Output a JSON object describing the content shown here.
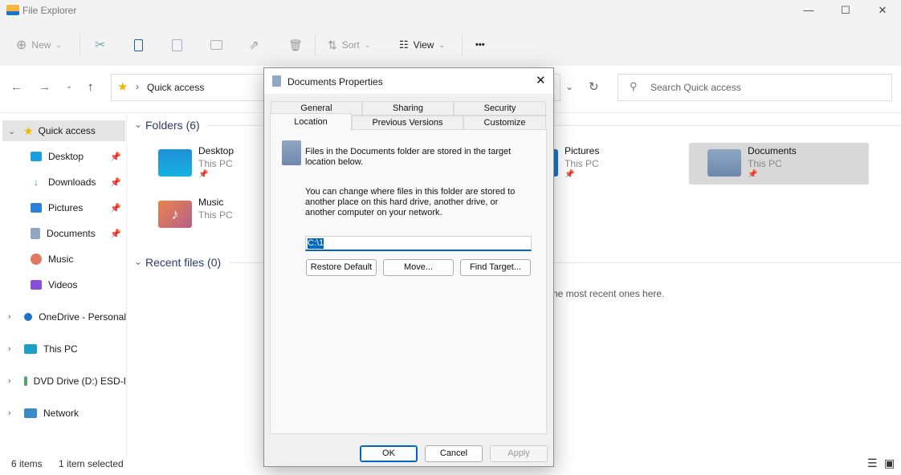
{
  "window": {
    "title": "File Explorer",
    "minimize": "—",
    "maximize": "☐",
    "close": "✕"
  },
  "toolbar": {
    "new": "New",
    "sort": "Sort",
    "view": "View",
    "more": "•••"
  },
  "address": {
    "path": "Quick access",
    "search_placeholder": "Search Quick access"
  },
  "sidebar": {
    "quick_access": "Quick access",
    "items": [
      {
        "label": "Desktop",
        "color": "#1aa0e0"
      },
      {
        "label": "Downloads",
        "color": "#1fa06a"
      },
      {
        "label": "Pictures",
        "color": "#2d7fd8"
      },
      {
        "label": "Documents",
        "color": "#8fa6c4"
      },
      {
        "label": "Music",
        "color": "#e07a5f"
      },
      {
        "label": "Videos",
        "color": "#8a4fd8"
      }
    ],
    "roots": [
      "OneDrive - Personal",
      "This PC",
      "DVD Drive (D:) ESD-I",
      "Network"
    ]
  },
  "main": {
    "folders_header": "Folders (6)",
    "folders": [
      {
        "name": "Desktop",
        "location": "This PC"
      },
      {
        "name": "Music",
        "location": "This PC"
      },
      {
        "name": "Pictures",
        "location": "This PC"
      },
      {
        "name": "Documents",
        "location": "This PC"
      }
    ],
    "recent_header": "Recent files (0)",
    "recent_empty": "he most recent ones here."
  },
  "status": {
    "count": "6 items",
    "selected": "1 item selected"
  },
  "dialog": {
    "title": "Documents Properties",
    "tabs_row1": [
      "General",
      "Sharing",
      "Security"
    ],
    "tabs_row2": [
      "Location",
      "Previous Versions",
      "Customize"
    ],
    "active_tab": "Location",
    "info": "Files in the Documents folder are stored in the target location below.",
    "explain": "You can change where files in this folder are stored to another place on this hard drive, another drive, or another computer on your network.",
    "path_value": "C:\\1",
    "restore": "Restore Default",
    "move": "Move...",
    "find": "Find Target...",
    "ok": "OK",
    "cancel": "Cancel",
    "apply": "Apply"
  },
  "colors": {
    "accent": "#0067c0",
    "selection": "#d9d9d9"
  }
}
